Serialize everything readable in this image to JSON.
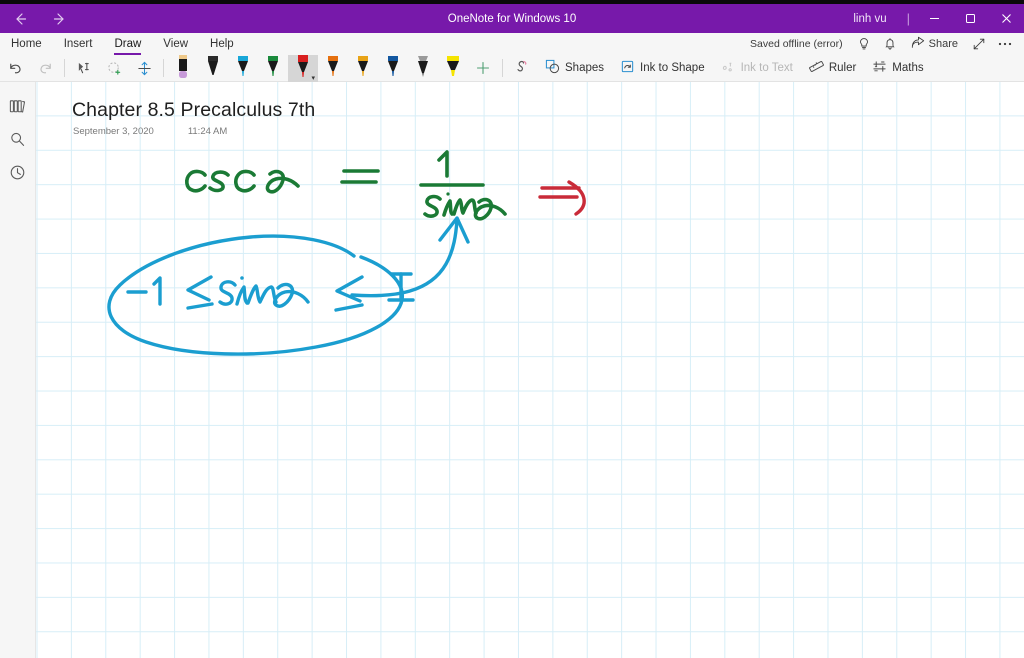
{
  "window": {
    "app_title": "OneNote for Windows 10",
    "user": "linh vu",
    "nav_back_icon": "arrow-left-icon",
    "nav_forward_icon": "arrow-right-icon",
    "minimize_label": "–",
    "maximize_label": "❐",
    "close_label": "✕",
    "separator": "|",
    "accent_color": "#7719aa"
  },
  "menubar": {
    "tabs": [
      {
        "label": "Home",
        "active": false
      },
      {
        "label": "Insert",
        "active": false
      },
      {
        "label": "Draw",
        "active": true
      },
      {
        "label": "View",
        "active": false
      },
      {
        "label": "Help",
        "active": false
      }
    ],
    "save_status": "Saved offline (error)",
    "tell_me_icon": "lightbulb-icon",
    "notifications_icon": "bell-icon",
    "share_label": "Share",
    "share_icon": "share-icon",
    "fullscreen_icon": "expand-arrow-icon",
    "more_icon": "ellipsis-icon"
  },
  "ribbon": {
    "undo_icon": "undo-icon",
    "redo_icon": "redo-icon",
    "lasso_icon": "lasso-select-icon",
    "eraser_icon": "eraser-icon",
    "insert_space_icon": "insert-space-icon",
    "add_pen_icon": "plus-icon",
    "ink_color_icon": "ink-color-icon",
    "pens": [
      {
        "name": "pencil-lavender",
        "type": "pencil",
        "color": "#c79ad9",
        "cap": "#efc98a",
        "selected": false
      },
      {
        "name": "pen-black",
        "type": "pen",
        "color": "#1a1a1a",
        "cap": "#2b2b2b",
        "selected": false
      },
      {
        "name": "pen-cyan",
        "type": "pen",
        "color": "#19a7d8",
        "cap": "#19a7d8",
        "selected": false
      },
      {
        "name": "pen-green",
        "type": "pen",
        "color": "#1a8a3c",
        "cap": "#1a8a3c",
        "selected": false
      },
      {
        "name": "pen-red",
        "type": "pen",
        "color": "#d91f1f",
        "cap": "#d91f1f",
        "selected": true
      },
      {
        "name": "pen-orange",
        "type": "pen",
        "color": "#e5700f",
        "cap": "#e5700f",
        "selected": false
      },
      {
        "name": "pen-amber",
        "type": "pen",
        "color": "#e8a317",
        "cap": "#e8a317",
        "selected": false
      },
      {
        "name": "pen-blue",
        "type": "pen",
        "color": "#1257a0",
        "cap": "#1257a0",
        "selected": false
      },
      {
        "name": "pencil-grey",
        "type": "pencil",
        "color": "#8a8a8a",
        "cap": "#8a8a8a",
        "selected": false
      },
      {
        "name": "highlighter-yellow",
        "type": "highlighter",
        "color": "#f5e400",
        "cap": "#f5e400",
        "selected": false
      }
    ],
    "tools": [
      {
        "label": "Shapes",
        "icon": "shapes-icon",
        "disabled": false
      },
      {
        "label": "Ink to Shape",
        "icon": "ink-to-shape-icon",
        "disabled": false
      },
      {
        "label": "Ink to Text",
        "icon": "ink-to-text-icon",
        "disabled": true
      },
      {
        "label": "Ruler",
        "icon": "ruler-icon",
        "disabled": false
      },
      {
        "label": "Maths",
        "icon": "maths-icon",
        "disabled": false
      }
    ]
  },
  "rail": {
    "items": [
      {
        "name": "notebooks-icon",
        "label": "Notebooks"
      },
      {
        "name": "search-icon",
        "label": "Search"
      },
      {
        "name": "recent-notes-icon",
        "label": "Recent Notes"
      }
    ]
  },
  "page": {
    "title": "Chapter 8.5 Precalculus 7th",
    "date": "September 3, 2020",
    "time": "11:24 AM",
    "grid_color": "#d7eef7",
    "ink": {
      "equation_green": {
        "text": "csc x = 1 / sin x",
        "color": "#1a7a35"
      },
      "implies_red": {
        "text": "⟹",
        "color": "#c92b39"
      },
      "inequality_blue": {
        "text": "-1 ≤ sin x ≤ 1",
        "color": "#1b9ed0"
      },
      "annotation_blue": {
        "text": "arrow from circled inequality to sin x",
        "color": "#1b9ed0"
      }
    }
  }
}
